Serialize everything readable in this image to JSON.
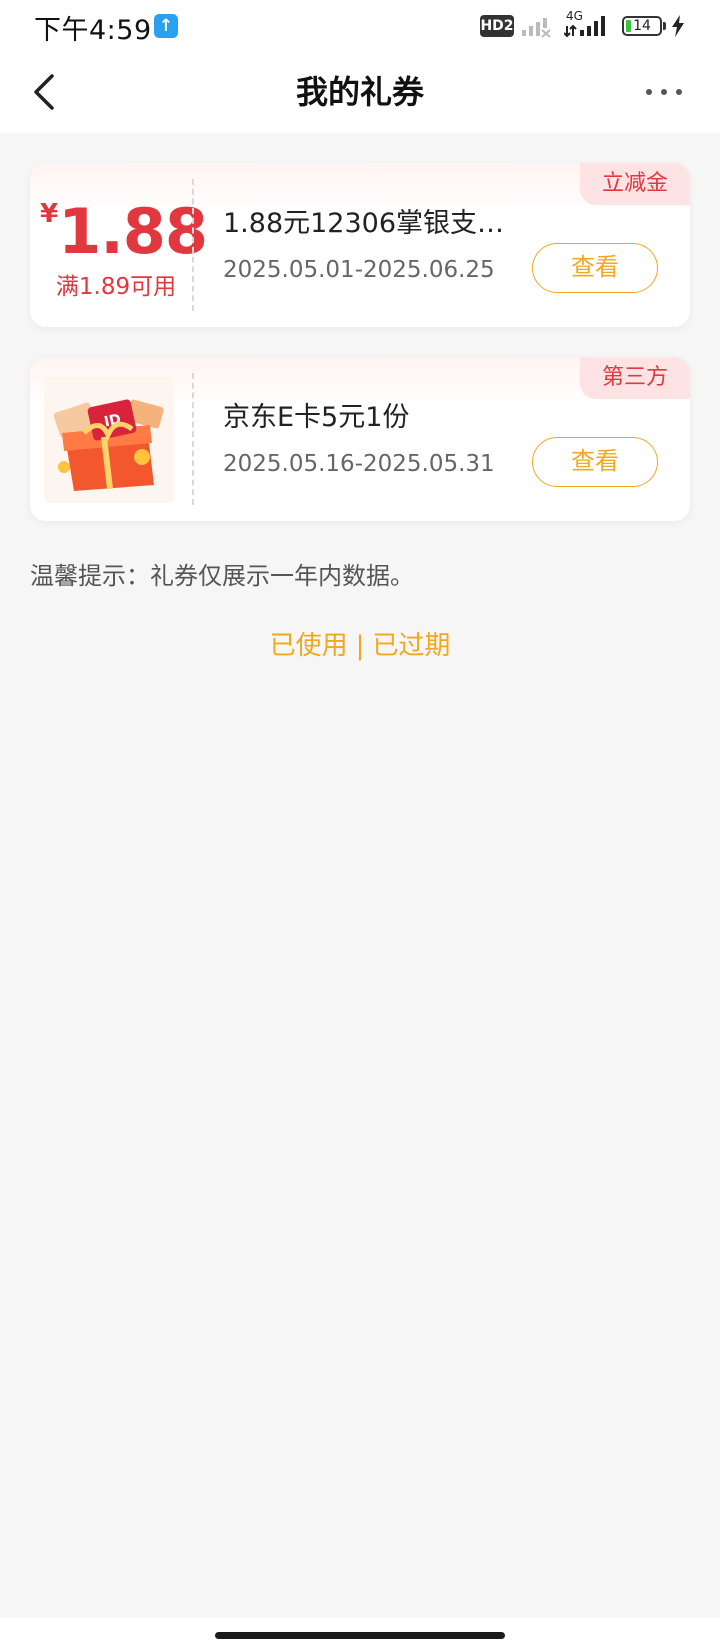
{
  "status_bar": {
    "time": "下午4:59",
    "upload_icon": "arrow-up-icon",
    "hd_label": "HD2",
    "network": "4G",
    "battery_level": "14",
    "charge_icon": "lightning-icon"
  },
  "nav": {
    "back_icon": "chevron-left-icon",
    "title": "我的礼券",
    "more_icon": "more-dots-icon"
  },
  "coupons": [
    {
      "currency": "¥",
      "amount": "1.88",
      "condition": "满1.89可用",
      "title": "1.88元12306掌银支…",
      "date_range": "2025.05.01-2025.06.25",
      "tag": "立减金",
      "button_label": "查看"
    },
    {
      "image_icon": "gift-box-icon",
      "title": "京东E卡5元1份",
      "date_range": "2025.05.16-2025.05.31",
      "tag": "第三方",
      "button_label": "查看"
    }
  ],
  "tip": "温馨提示：礼券仅展示一年内数据。",
  "history": {
    "used": "已使用",
    "separator": "|",
    "expired": "已过期"
  },
  "colors": {
    "accent_red": "#e0383e",
    "accent_orange": "#f0a81e",
    "background": "#f6f6f6"
  }
}
